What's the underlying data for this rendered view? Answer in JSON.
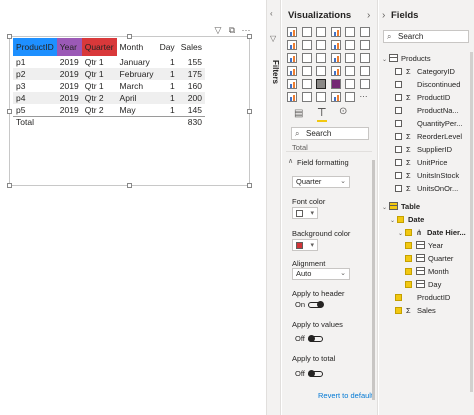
{
  "canvas": {
    "table": {
      "headers": [
        "ProductID",
        "Year",
        "Quarter",
        "Month",
        "Day",
        "Sales"
      ],
      "header_colors": [
        "#1e90ff",
        "#9b59b6",
        "#d9383a",
        "",
        "",
        ""
      ],
      "rows": [
        [
          "p1",
          "2019",
          "Qtr 1",
          "January",
          "1",
          "155"
        ],
        [
          "p2",
          "2019",
          "Qtr 1",
          "February",
          "1",
          "175"
        ],
        [
          "p3",
          "2019",
          "Qtr 1",
          "March",
          "1",
          "160"
        ],
        [
          "p4",
          "2019",
          "Qtr 2",
          "April",
          "1",
          "200"
        ],
        [
          "p5",
          "2019",
          "Qtr 2",
          "May",
          "1",
          "145"
        ]
      ],
      "total_label": "Total",
      "total_value": "830"
    }
  },
  "filters": {
    "label": "Filters"
  },
  "visualizations": {
    "title": "Visualizations",
    "search_placeholder": "Search",
    "collapsed_section": "Total",
    "field_formatting": {
      "title": "Field formatting",
      "field_value": "Quarter",
      "font_color_label": "Font color",
      "font_color": "#ffffff",
      "background_color_label": "Background color",
      "background_color": "#d13438",
      "alignment_label": "Alignment",
      "alignment_value": "Auto",
      "apply_header_label": "Apply to header",
      "apply_header_state": "On",
      "apply_values_label": "Apply to values",
      "apply_values_state": "Off",
      "apply_total_label": "Apply to total",
      "apply_total_state": "Off"
    },
    "revert_label": "Revert to default"
  },
  "fields": {
    "title": "Fields",
    "search_placeholder": "Search",
    "products_table": "Products",
    "products_fields": [
      {
        "name": "CategoryID",
        "sigma": true
      },
      {
        "name": "Discontinued",
        "sigma": false
      },
      {
        "name": "ProductID",
        "sigma": true
      },
      {
        "name": "ProductNa...",
        "sigma": false
      },
      {
        "name": "QuantityPer...",
        "sigma": false
      },
      {
        "name": "ReorderLevel",
        "sigma": true
      },
      {
        "name": "SupplierID",
        "sigma": true
      },
      {
        "name": "UnitPrice",
        "sigma": true
      },
      {
        "name": "UnitsInStock",
        "sigma": true
      },
      {
        "name": "UnitsOnOr...",
        "sigma": true
      }
    ],
    "table_table": "Table",
    "date_field": "Date",
    "date_hierarchy": "Date Hier...",
    "hierarchy_levels": [
      "Year",
      "Quarter",
      "Month",
      "Day"
    ],
    "table_fields": [
      {
        "name": "ProductID",
        "sigma": false
      },
      {
        "name": "Sales",
        "sigma": true
      }
    ]
  }
}
